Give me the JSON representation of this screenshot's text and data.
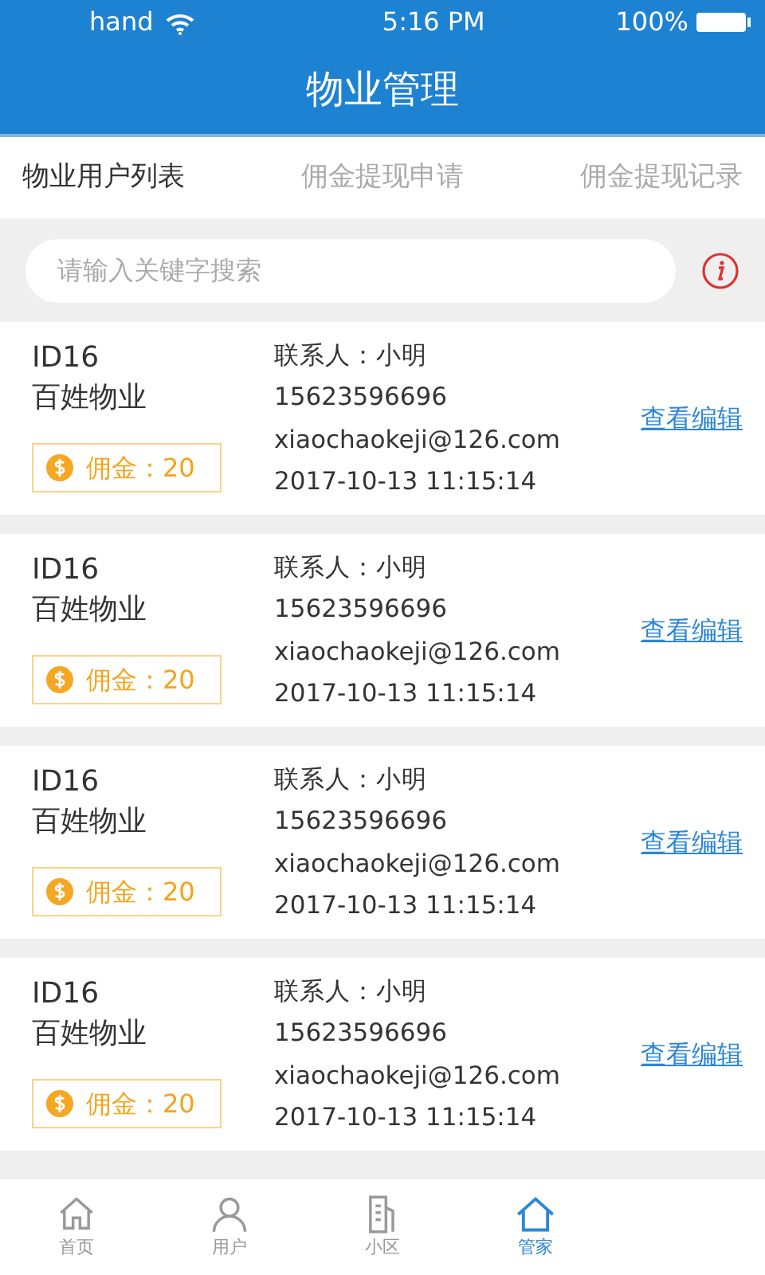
{
  "status_bar": {
    "carrier": "hand",
    "time": "5:16 PM",
    "battery": "100%"
  },
  "title": "物业管理",
  "tabs": [
    {
      "label": "物业用户列表",
      "selected": true
    },
    {
      "label": "佣金提现申请",
      "selected": false
    },
    {
      "label": "佣金提现记录",
      "selected": false
    }
  ],
  "search": {
    "placeholder": "请输入关键字搜索"
  },
  "items": [
    {
      "id": "ID16",
      "name": "百姓物业",
      "commission": "佣金：20",
      "contact": "联系人：小明",
      "phone": "15623596696",
      "email": "xiaochaokeji@126.com",
      "time": "2017-10-13 11:15:14",
      "action": "查看编辑"
    },
    {
      "id": "ID16",
      "name": "百姓物业",
      "commission": "佣金：20",
      "contact": "联系人：小明",
      "phone": "15623596696",
      "email": "xiaochaokeji@126.com",
      "time": "2017-10-13 11:15:14",
      "action": "查看编辑"
    },
    {
      "id": "ID16",
      "name": "百姓物业",
      "commission": "佣金：20",
      "contact": "联系人：小明",
      "phone": "15623596696",
      "email": "xiaochaokeji@126.com",
      "time": "2017-10-13 11:15:14",
      "action": "查看编辑"
    },
    {
      "id": "ID16",
      "name": "百姓物业",
      "commission": "佣金：20",
      "contact": "联系人：小明",
      "phone": "15623596696",
      "email": "xiaochaokeji@126.com",
      "time": "2017-10-13 11:15:14",
      "action": "查看编辑"
    }
  ],
  "bottom_nav": [
    {
      "label": "首页",
      "kind": "home",
      "selected": false
    },
    {
      "label": "用户",
      "kind": "user",
      "selected": false
    },
    {
      "label": "小区",
      "kind": "building",
      "selected": false
    },
    {
      "label": "管家",
      "kind": "house",
      "selected": true
    }
  ]
}
